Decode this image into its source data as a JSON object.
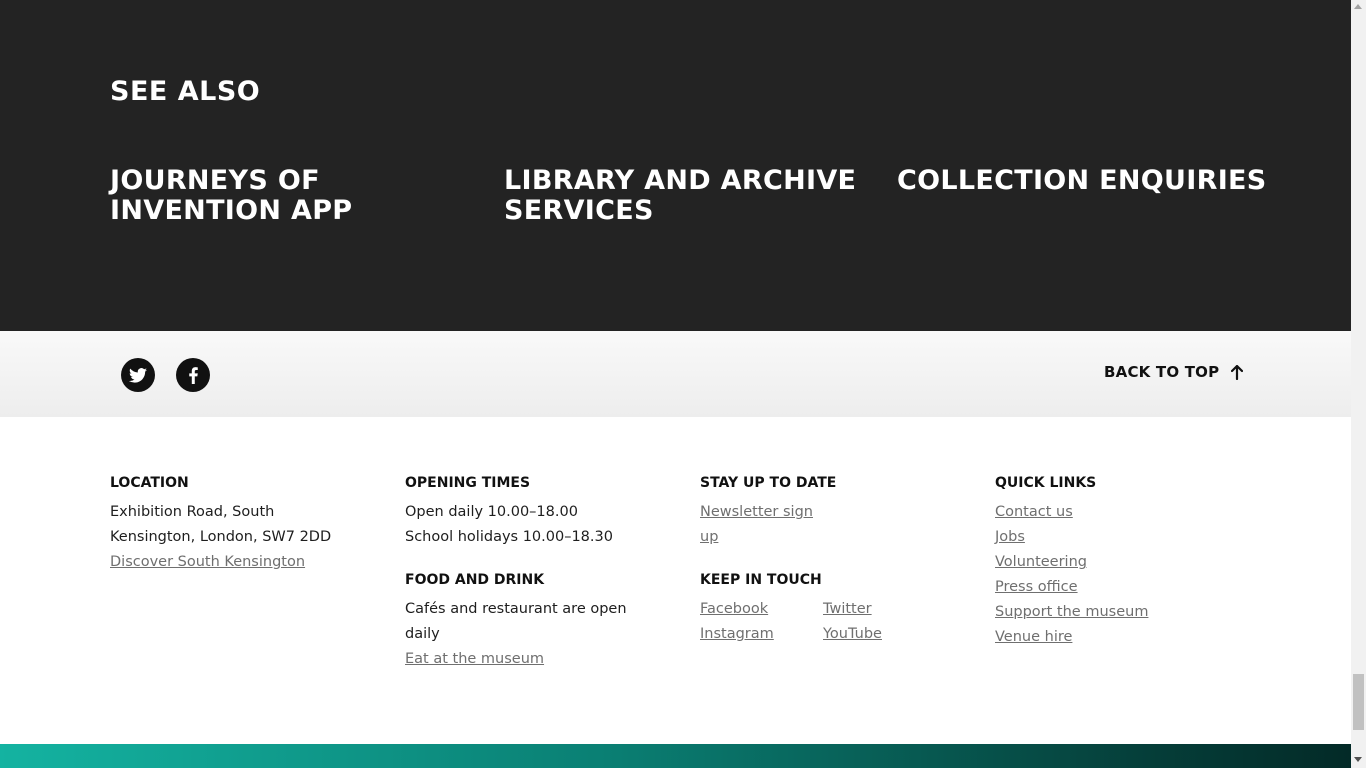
{
  "see_also": {
    "title": "SEE ALSO",
    "links": [
      "JOURNEYS OF INVENTION APP",
      "LIBRARY AND ARCHIVE SERVICES",
      "COLLECTION ENQUIRIES"
    ]
  },
  "social_bar": {
    "icons": [
      "twitter-icon",
      "facebook-icon"
    ],
    "back_to_top": "BACK TO TOP"
  },
  "footer": {
    "location": {
      "heading": "LOCATION",
      "address": "Exhibition Road, South Kensington, London, SW7 2DD",
      "link": "Discover South Kensington"
    },
    "opening_times": {
      "heading": "OPENING TIMES",
      "line1": "Open daily 10.00–18.00",
      "line2": "School holidays 10.00–18.30"
    },
    "food_and_drink": {
      "heading": "FOOD AND DRINK",
      "text": "Cafés and restaurant are open daily",
      "link": "Eat at the museum"
    },
    "stay_up_to_date": {
      "heading": "STAY UP TO DATE",
      "link": "Newsletter sign up"
    },
    "keep_in_touch": {
      "heading": "KEEP IN TOUCH",
      "links": [
        "Facebook",
        "Twitter",
        "Instagram",
        "YouTube"
      ]
    },
    "quick_links": {
      "heading": "QUICK LINKS",
      "links": [
        "Contact us",
        "Jobs",
        "Volunteering",
        "Press office",
        "Support the museum",
        "Venue hire"
      ]
    }
  },
  "colors": {
    "dark_bg": "#232323",
    "link_grey": "#6f6f6f",
    "strip_start": "#14b3a1",
    "strip_end": "#032a27"
  }
}
